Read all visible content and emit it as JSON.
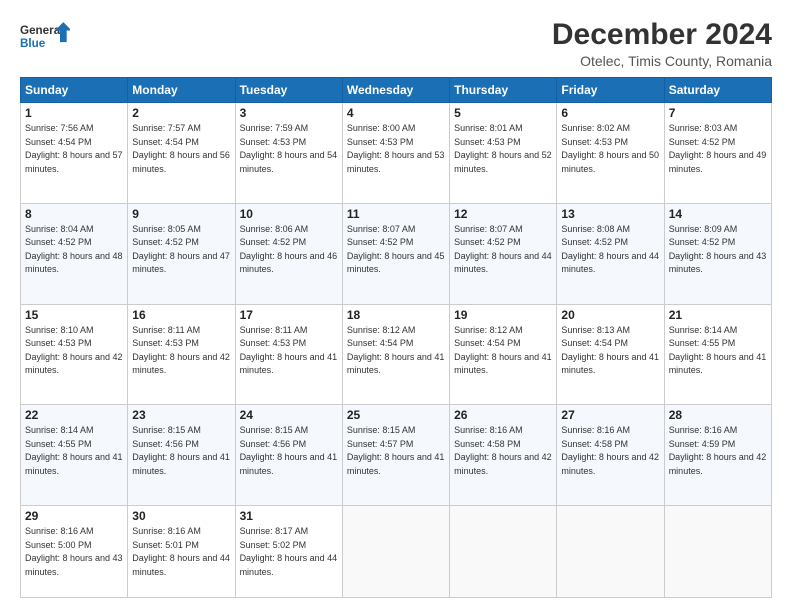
{
  "logo": {
    "line1": "General",
    "line2": "Blue"
  },
  "title": "December 2024",
  "subtitle": "Otelec, Timis County, Romania",
  "weekdays": [
    "Sunday",
    "Monday",
    "Tuesday",
    "Wednesday",
    "Thursday",
    "Friday",
    "Saturday"
  ],
  "weeks": [
    [
      {
        "day": "1",
        "sunrise": "7:56 AM",
        "sunset": "4:54 PM",
        "daylight": "8 hours and 57 minutes."
      },
      {
        "day": "2",
        "sunrise": "7:57 AM",
        "sunset": "4:54 PM",
        "daylight": "8 hours and 56 minutes."
      },
      {
        "day": "3",
        "sunrise": "7:59 AM",
        "sunset": "4:53 PM",
        "daylight": "8 hours and 54 minutes."
      },
      {
        "day": "4",
        "sunrise": "8:00 AM",
        "sunset": "4:53 PM",
        "daylight": "8 hours and 53 minutes."
      },
      {
        "day": "5",
        "sunrise": "8:01 AM",
        "sunset": "4:53 PM",
        "daylight": "8 hours and 52 minutes."
      },
      {
        "day": "6",
        "sunrise": "8:02 AM",
        "sunset": "4:53 PM",
        "daylight": "8 hours and 50 minutes."
      },
      {
        "day": "7",
        "sunrise": "8:03 AM",
        "sunset": "4:52 PM",
        "daylight": "8 hours and 49 minutes."
      }
    ],
    [
      {
        "day": "8",
        "sunrise": "8:04 AM",
        "sunset": "4:52 PM",
        "daylight": "8 hours and 48 minutes."
      },
      {
        "day": "9",
        "sunrise": "8:05 AM",
        "sunset": "4:52 PM",
        "daylight": "8 hours and 47 minutes."
      },
      {
        "day": "10",
        "sunrise": "8:06 AM",
        "sunset": "4:52 PM",
        "daylight": "8 hours and 46 minutes."
      },
      {
        "day": "11",
        "sunrise": "8:07 AM",
        "sunset": "4:52 PM",
        "daylight": "8 hours and 45 minutes."
      },
      {
        "day": "12",
        "sunrise": "8:07 AM",
        "sunset": "4:52 PM",
        "daylight": "8 hours and 44 minutes."
      },
      {
        "day": "13",
        "sunrise": "8:08 AM",
        "sunset": "4:52 PM",
        "daylight": "8 hours and 44 minutes."
      },
      {
        "day": "14",
        "sunrise": "8:09 AM",
        "sunset": "4:52 PM",
        "daylight": "8 hours and 43 minutes."
      }
    ],
    [
      {
        "day": "15",
        "sunrise": "8:10 AM",
        "sunset": "4:53 PM",
        "daylight": "8 hours and 42 minutes."
      },
      {
        "day": "16",
        "sunrise": "8:11 AM",
        "sunset": "4:53 PM",
        "daylight": "8 hours and 42 minutes."
      },
      {
        "day": "17",
        "sunrise": "8:11 AM",
        "sunset": "4:53 PM",
        "daylight": "8 hours and 41 minutes."
      },
      {
        "day": "18",
        "sunrise": "8:12 AM",
        "sunset": "4:54 PM",
        "daylight": "8 hours and 41 minutes."
      },
      {
        "day": "19",
        "sunrise": "8:12 AM",
        "sunset": "4:54 PM",
        "daylight": "8 hours and 41 minutes."
      },
      {
        "day": "20",
        "sunrise": "8:13 AM",
        "sunset": "4:54 PM",
        "daylight": "8 hours and 41 minutes."
      },
      {
        "day": "21",
        "sunrise": "8:14 AM",
        "sunset": "4:55 PM",
        "daylight": "8 hours and 41 minutes."
      }
    ],
    [
      {
        "day": "22",
        "sunrise": "8:14 AM",
        "sunset": "4:55 PM",
        "daylight": "8 hours and 41 minutes."
      },
      {
        "day": "23",
        "sunrise": "8:15 AM",
        "sunset": "4:56 PM",
        "daylight": "8 hours and 41 minutes."
      },
      {
        "day": "24",
        "sunrise": "8:15 AM",
        "sunset": "4:56 PM",
        "daylight": "8 hours and 41 minutes."
      },
      {
        "day": "25",
        "sunrise": "8:15 AM",
        "sunset": "4:57 PM",
        "daylight": "8 hours and 41 minutes."
      },
      {
        "day": "26",
        "sunrise": "8:16 AM",
        "sunset": "4:58 PM",
        "daylight": "8 hours and 42 minutes."
      },
      {
        "day": "27",
        "sunrise": "8:16 AM",
        "sunset": "4:58 PM",
        "daylight": "8 hours and 42 minutes."
      },
      {
        "day": "28",
        "sunrise": "8:16 AM",
        "sunset": "4:59 PM",
        "daylight": "8 hours and 42 minutes."
      }
    ],
    [
      {
        "day": "29",
        "sunrise": "8:16 AM",
        "sunset": "5:00 PM",
        "daylight": "8 hours and 43 minutes."
      },
      {
        "day": "30",
        "sunrise": "8:16 AM",
        "sunset": "5:01 PM",
        "daylight": "8 hours and 44 minutes."
      },
      {
        "day": "31",
        "sunrise": "8:17 AM",
        "sunset": "5:02 PM",
        "daylight": "8 hours and 44 minutes."
      },
      null,
      null,
      null,
      null
    ]
  ]
}
